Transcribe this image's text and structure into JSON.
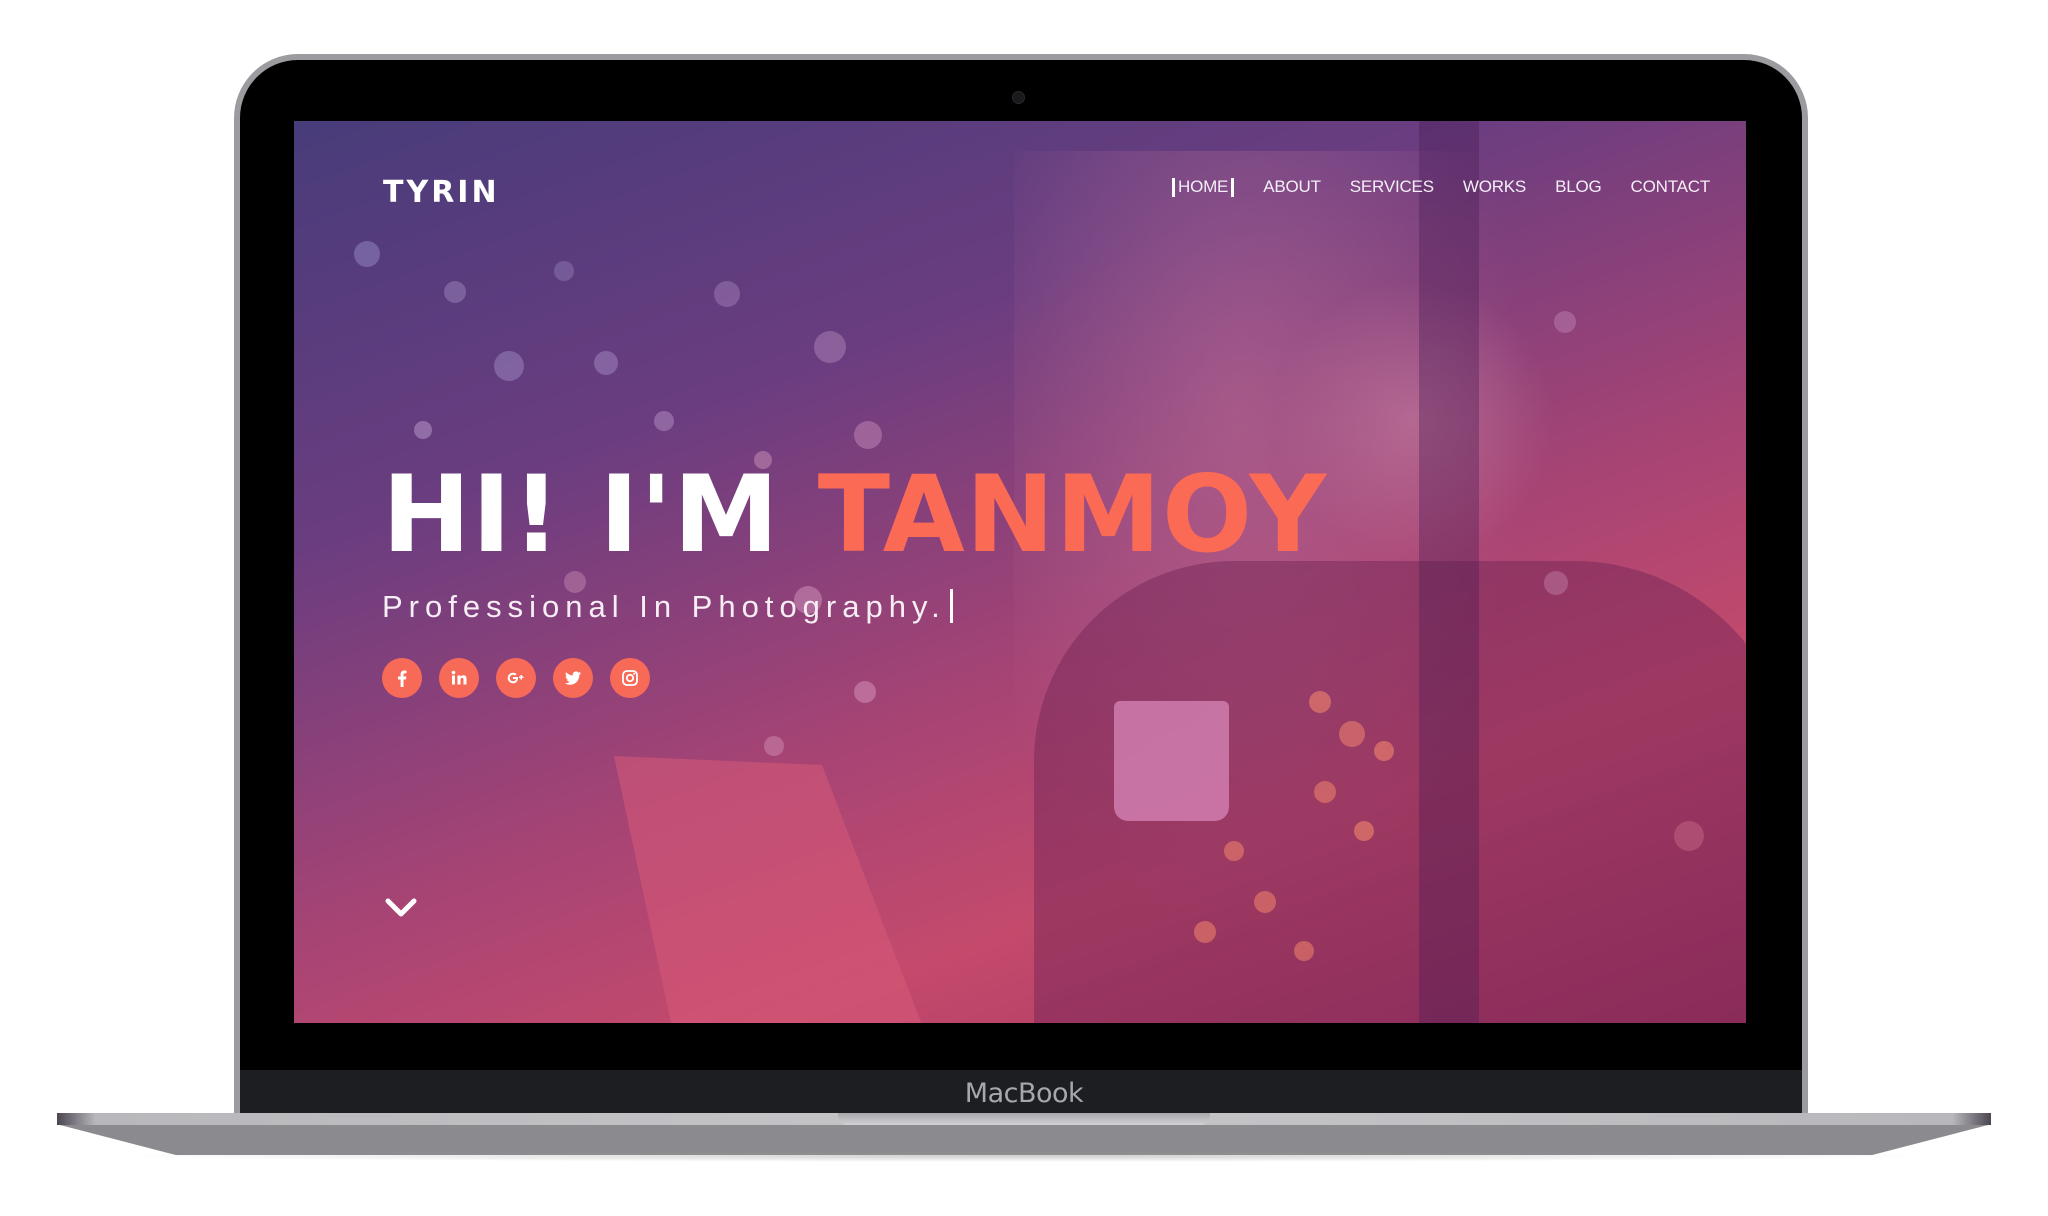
{
  "device": {
    "label": "MacBook"
  },
  "site": {
    "brand": "TYRIN",
    "nav": [
      {
        "label": "HOME",
        "active": true
      },
      {
        "label": "ABOUT",
        "active": false
      },
      {
        "label": "SERVICES",
        "active": false
      },
      {
        "label": "WORKS",
        "active": false
      },
      {
        "label": "BLOG",
        "active": false
      },
      {
        "label": "CONTACT",
        "active": false
      }
    ],
    "hero": {
      "greeting": "HI! I'M",
      "name": "TANMOY",
      "subtitle": "Professional In Photography."
    },
    "socials": [
      {
        "name": "facebook",
        "icon": "facebook-icon"
      },
      {
        "name": "linkedin",
        "icon": "linkedin-icon"
      },
      {
        "name": "google-plus",
        "icon": "google-plus-icon"
      },
      {
        "name": "twitter",
        "icon": "twitter-icon"
      },
      {
        "name": "instagram",
        "icon": "instagram-icon"
      }
    ],
    "scroll_icon": "chevron-down-icon",
    "colors": {
      "accent": "#fb6a55",
      "overlay_top": "#483c7a",
      "overlay_bottom": "#c44a6c"
    }
  }
}
